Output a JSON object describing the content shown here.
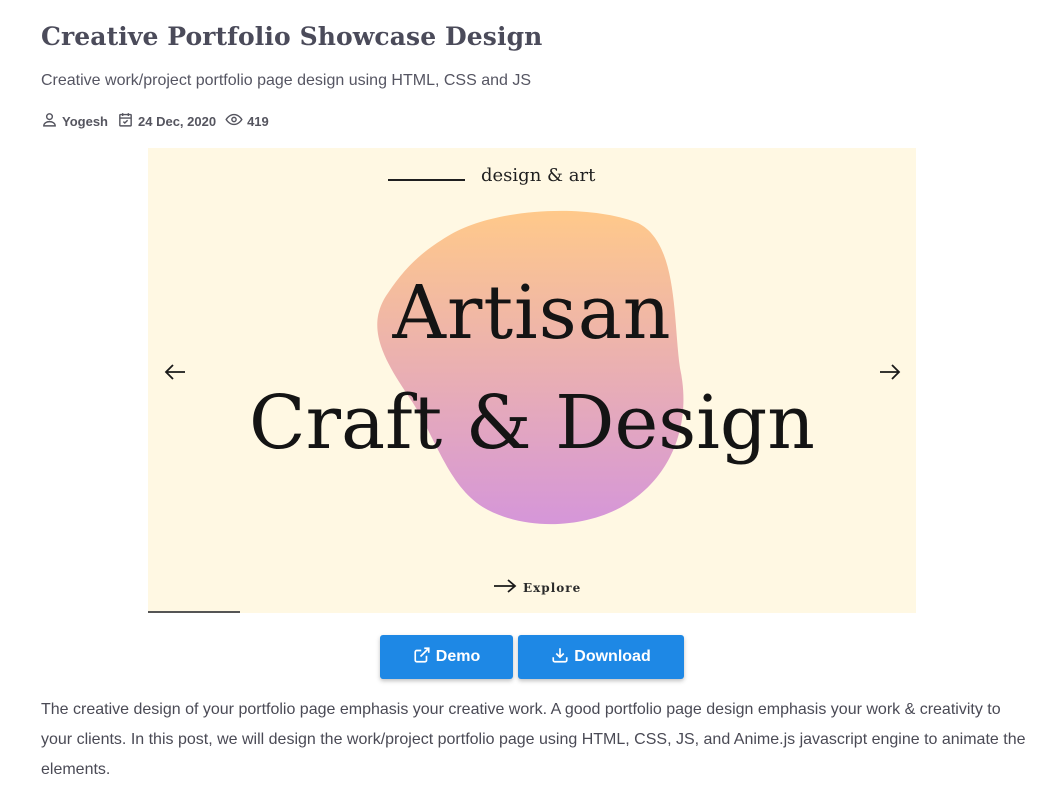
{
  "article": {
    "title": "Creative Portfolio Showcase Design",
    "subtitle": "Creative work/project portfolio page design using HTML, CSS and JS",
    "author": "Yogesh",
    "date": "24 Dec, 2020",
    "views": "419"
  },
  "hero": {
    "kicker": "design & art",
    "headline_line1": "Artisan",
    "headline_line2": "Craft & Design",
    "explore_label": "Explore",
    "background_color": "#fff8e3",
    "blob_gradient_top": "#ffc98a",
    "blob_gradient_bottom": "#d596d9",
    "slide_progress": 0.12
  },
  "actions": {
    "demo_label": "Demo",
    "download_label": "Download",
    "button_color": "#1e88e5"
  },
  "body": {
    "paragraph": "The creative design of your portfolio page emphasis your creative work. A good portfolio page design emphasis your work & creativity to your clients. In this post, we will design the work/project portfolio page using HTML, CSS, JS, and Anime.js javascript engine to animate the elements."
  },
  "icons": {
    "author": "user-icon",
    "date": "calendar-check-icon",
    "views": "eye-icon",
    "prev": "arrow-left-icon",
    "next": "arrow-right-icon",
    "explore": "arrow-right-long-icon",
    "demo": "external-link-icon",
    "download": "download-icon"
  }
}
